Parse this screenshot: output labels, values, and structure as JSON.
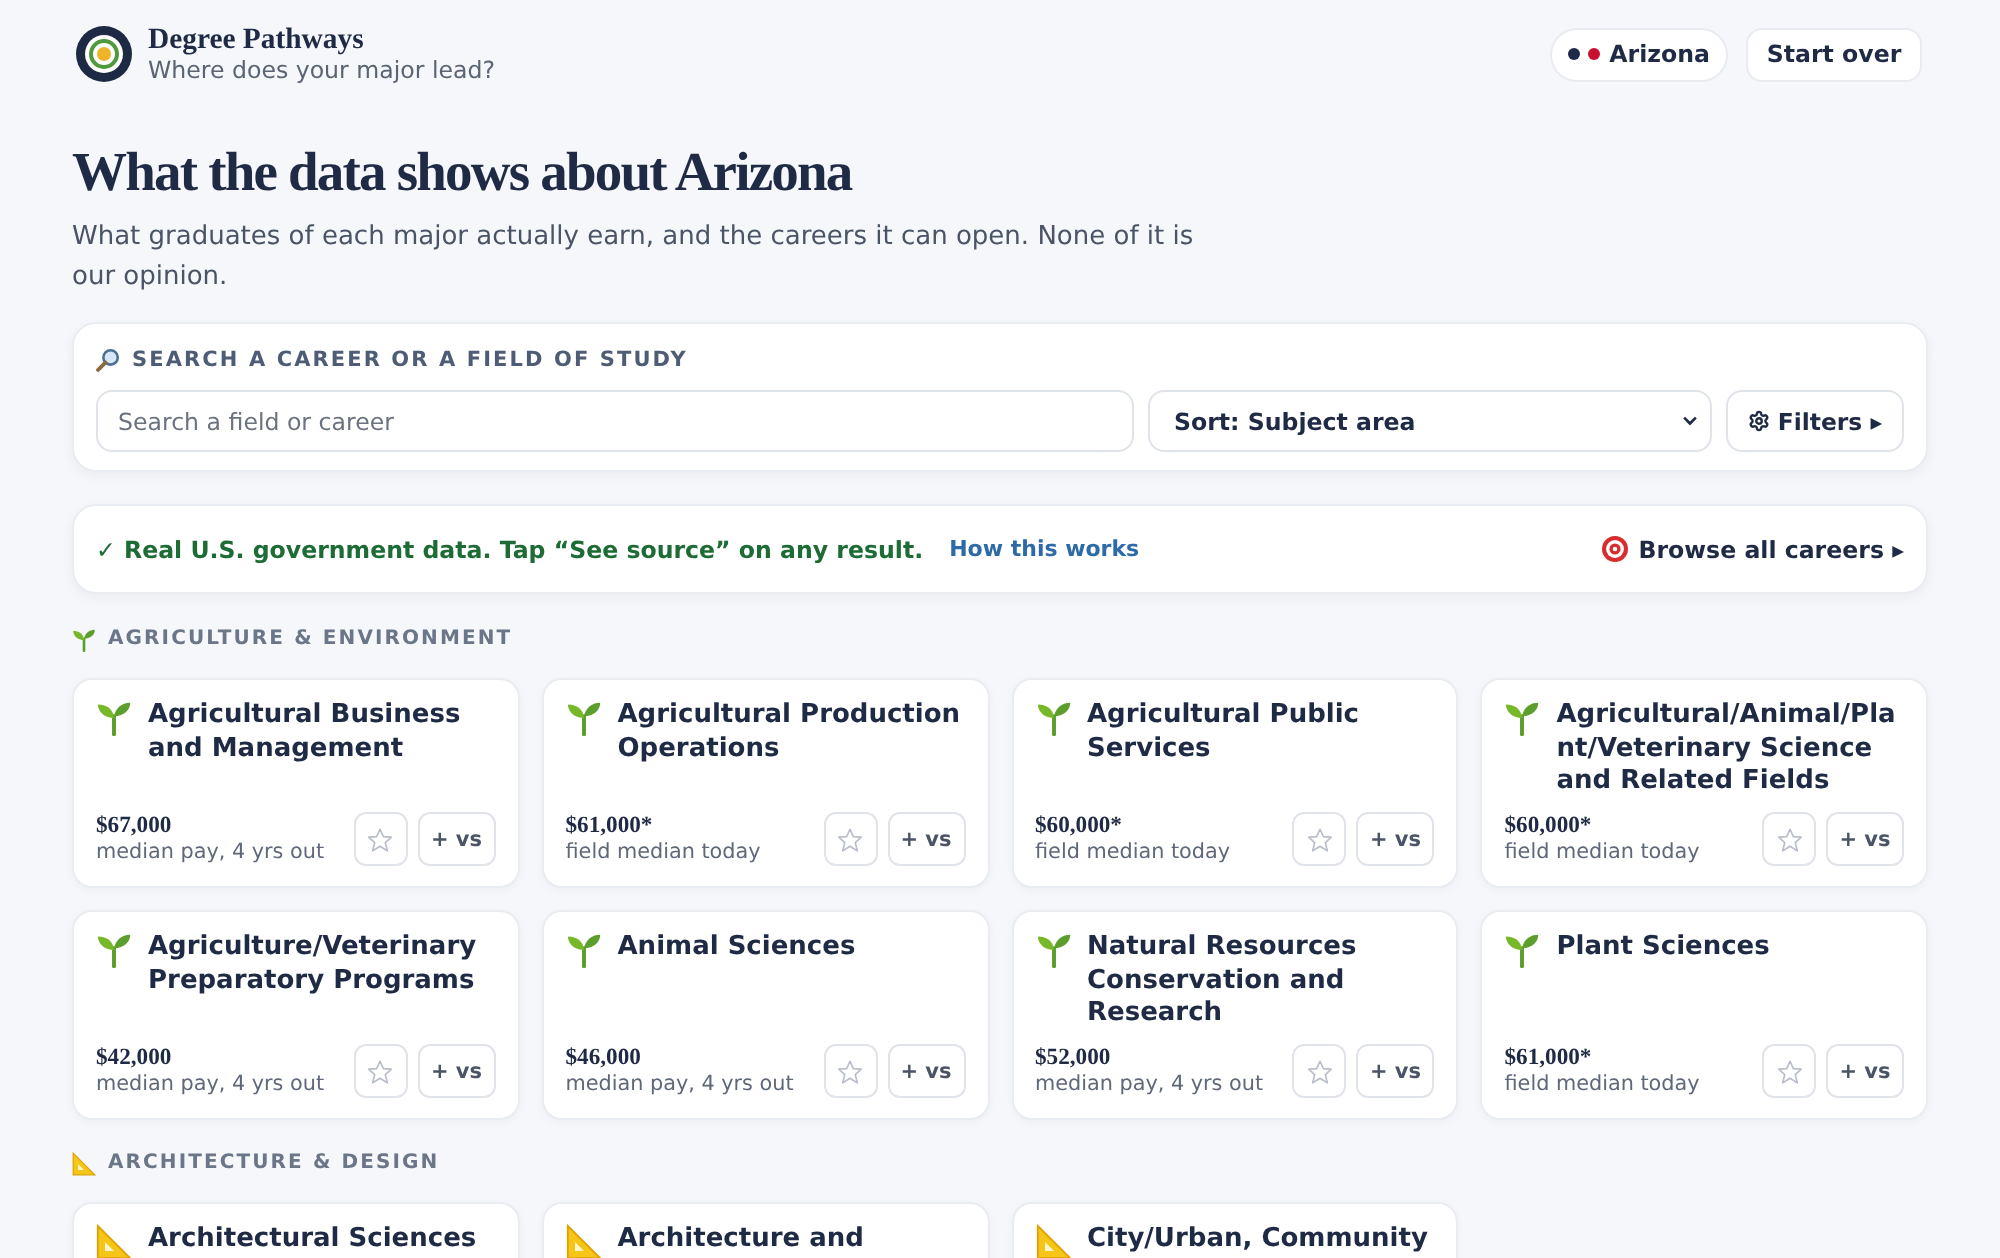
{
  "header": {
    "title": "Degree Pathways",
    "tagline": "Where does your major lead?",
    "location": "Arizona",
    "reset_button": "Start over"
  },
  "intro": {
    "heading": "What the data shows about Arizona",
    "description": "What graduates of each major actually earn, and the careers it can open. None of it is our opinion."
  },
  "search": {
    "label": "SEARCH A CAREER OR A FIELD OF STUDY",
    "placeholder": "Search a field or career",
    "sort": "Sort: Subject area",
    "filters_button": "Filters ▸"
  },
  "notice": {
    "text": "✓ Real U.S. government data. Tap “See source” on any result.",
    "link": "How this works",
    "browse_button": "Browse all careers ▸"
  },
  "sections": [
    {
      "kind": "agriculture",
      "title": "AGRICULTURE & ENVIRONMENT",
      "majors": [
        {
          "title": "Agricultural Business and Management",
          "salary": "$67,000",
          "salary_note": "median pay, 4 yrs out",
          "saved": false,
          "compare_button": "+ vs"
        },
        {
          "title": "Agricultural Production Operations",
          "salary": "$61,000*",
          "salary_note": "field median today",
          "saved": false,
          "compare_button": "+ vs"
        },
        {
          "title": "Agricultural Public Services",
          "salary": "$60,000*",
          "salary_note": "field median today",
          "saved": false,
          "compare_button": "+ vs"
        },
        {
          "title": "Agricultural/Animal/Plant/Veterinary Science and Related Fields",
          "salary": "$60,000*",
          "salary_note": "field median today",
          "saved": false,
          "compare_button": "+ vs"
        },
        {
          "title": "Agriculture/Veterinary Preparatory Programs",
          "salary": "$42,000",
          "salary_note": "median pay, 4 yrs out",
          "saved": false,
          "compare_button": "+ vs"
        },
        {
          "title": "Animal Sciences",
          "salary": "$46,000",
          "salary_note": "median pay, 4 yrs out",
          "saved": false,
          "compare_button": "+ vs"
        },
        {
          "title": "Natural Resources Conservation and Research",
          "salary": "$52,000",
          "salary_note": "median pay, 4 yrs out",
          "saved": false,
          "compare_button": "+ vs"
        },
        {
          "title": "Plant Sciences",
          "salary": "$61,000*",
          "salary_note": "field median today",
          "saved": false,
          "compare_button": "+ vs"
        }
      ]
    },
    {
      "kind": "architecture",
      "title": "ARCHITECTURE & DESIGN",
      "majors": [
        {
          "title": "Architectural Sciences"
        },
        {
          "title": "Architecture and"
        },
        {
          "title": "City/Urban, Community"
        }
      ]
    }
  ]
}
